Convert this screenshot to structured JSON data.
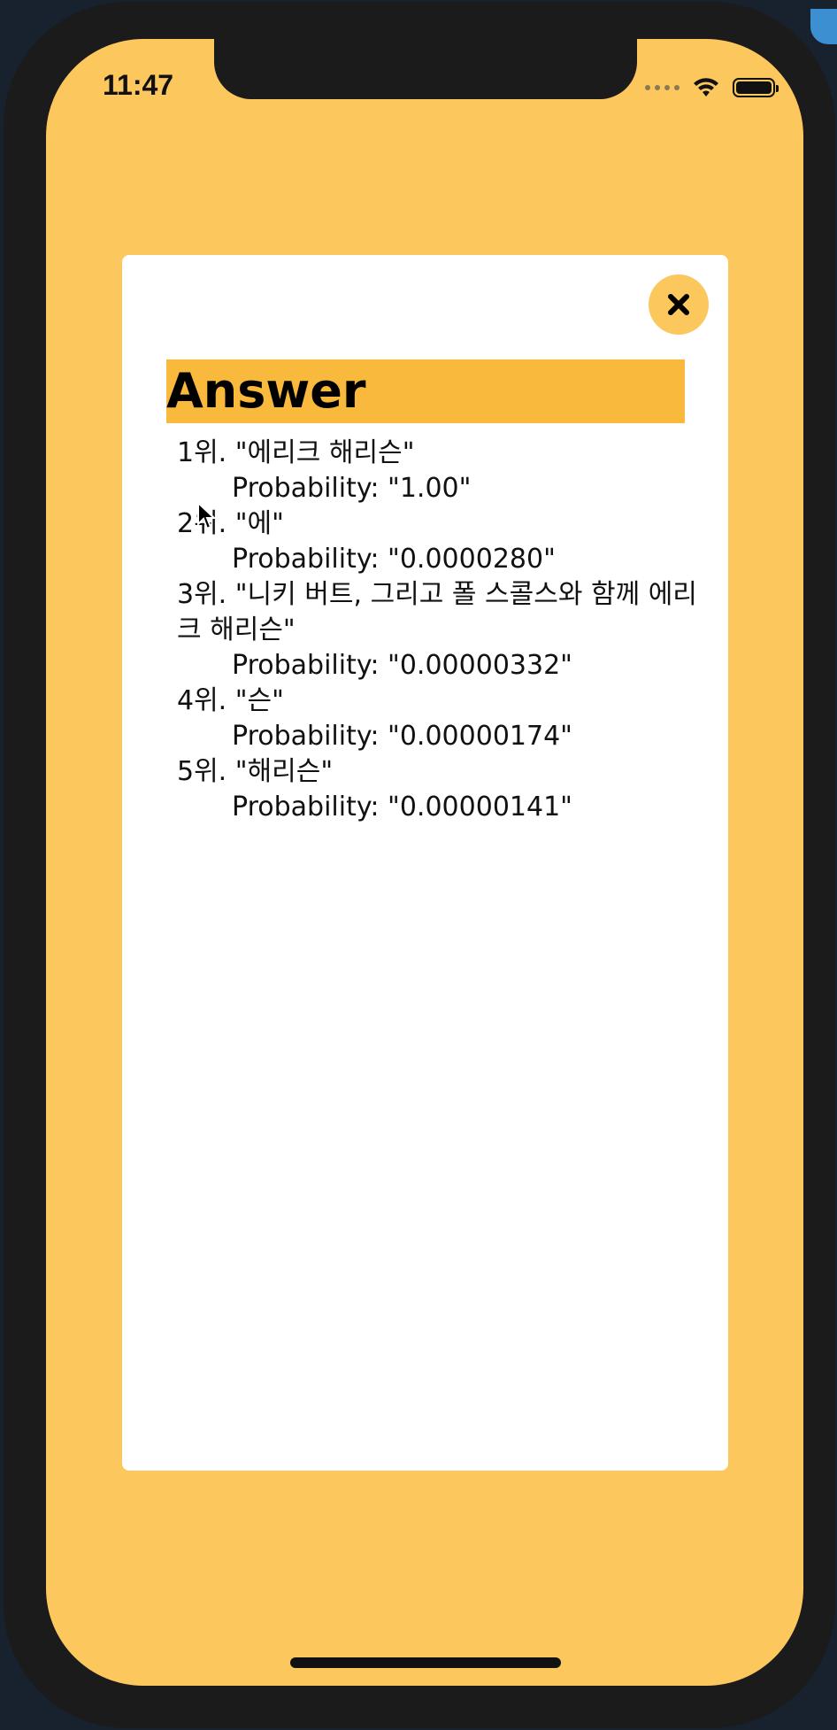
{
  "status_bar": {
    "time": "11:47",
    "icons": [
      "signal-icon",
      "wifi-icon",
      "battery-icon"
    ]
  },
  "close_button": {
    "icon": "close-icon"
  },
  "answer": {
    "heading": "Answer",
    "results": [
      {
        "rank": "1위. \"에리크 해리슨\"",
        "probability": "Probability: \"1.00\""
      },
      {
        "rank": "2위. \"에\"",
        "probability": "Probability: \"0.0000280\""
      },
      {
        "rank": "3위. \"니키 버트, 그리고 폴 스콜스와 함께 에리크 해리슨\"",
        "probability": "Probability: \"0.00000332\""
      },
      {
        "rank": "4위. \"슨\"",
        "probability": "Probability: \"0.00000174\""
      },
      {
        "rank": "5위. \"해리슨\"",
        "probability": "Probability: \"0.00000141\""
      }
    ]
  },
  "colors": {
    "background": "#fcc75c",
    "heading_bg": "#f9b93c",
    "card": "#ffffff"
  }
}
